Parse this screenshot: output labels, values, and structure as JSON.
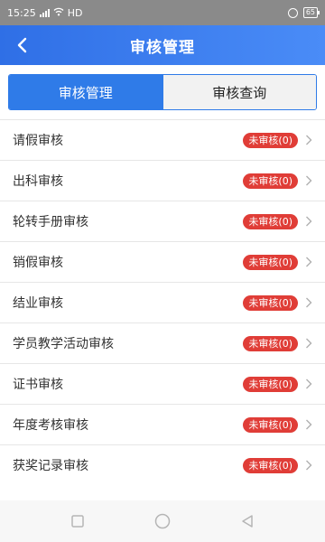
{
  "status_bar": {
    "time": "15:25",
    "network": "HD",
    "battery": "65"
  },
  "nav": {
    "title": "审核管理",
    "back_icon": "chevron-left-icon"
  },
  "tabs": [
    {
      "label": "审核管理",
      "active": true
    },
    {
      "label": "审核查询",
      "active": false
    }
  ],
  "colors": {
    "primary": "#2f7be8",
    "badge": "#e03d37"
  },
  "items": [
    {
      "label": "请假审核",
      "badge": "未审核(0)"
    },
    {
      "label": "出科审核",
      "badge": "未审核(0)"
    },
    {
      "label": "轮转手册审核",
      "badge": "未审核(0)"
    },
    {
      "label": "销假审核",
      "badge": "未审核(0)"
    },
    {
      "label": "结业审核",
      "badge": "未审核(0)"
    },
    {
      "label": "学员教学活动审核",
      "badge": "未审核(0)"
    },
    {
      "label": "证书审核",
      "badge": "未审核(0)"
    },
    {
      "label": "年度考核审核",
      "badge": "未审核(0)"
    },
    {
      "label": "获奖记录审核",
      "badge": "未审核(0)"
    }
  ],
  "system_nav": {
    "recent_icon": "square-icon",
    "home_icon": "circle-icon",
    "back_icon": "triangle-back-icon"
  }
}
